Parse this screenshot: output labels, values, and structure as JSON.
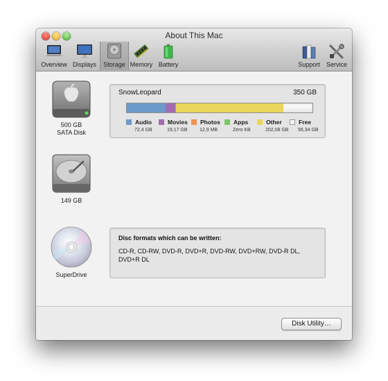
{
  "window": {
    "title": "About This Mac"
  },
  "toolbar": {
    "items": [
      {
        "label": "Overview",
        "icon": "monitor-icon"
      },
      {
        "label": "Displays",
        "icon": "display-icon"
      },
      {
        "label": "Storage",
        "icon": "hard-drive-icon",
        "selected": true
      },
      {
        "label": "Memory",
        "icon": "memory-chip-icon"
      },
      {
        "label": "Battery",
        "icon": "battery-icon"
      },
      {
        "label": "Support",
        "icon": "support-books-icon"
      },
      {
        "label": "Service",
        "icon": "service-tools-icon"
      }
    ]
  },
  "devices": [
    {
      "icon": "hard-drive-icon",
      "label_line1": "500 GB",
      "label_line2": "SATA Disk",
      "volume": {
        "name": "SnowLeopard",
        "capacity": "350 GB",
        "usage_fractions": {
          "audio": 0.21,
          "movies": 0.05,
          "photos": 0.003,
          "apps": 0.002,
          "other": 0.58,
          "free": 0.155
        },
        "legend": [
          {
            "key": "audio",
            "name": "Audio",
            "size": "72,4 GB",
            "color": "#6d9ac9"
          },
          {
            "key": "movies",
            "name": "Movies",
            "size": "19,17 GB",
            "color": "#a56bb0"
          },
          {
            "key": "photos",
            "name": "Photos",
            "size": "12,9 MB",
            "color": "#f0944f"
          },
          {
            "key": "apps",
            "name": "Apps",
            "size": "Zero KB",
            "color": "#7cc46a"
          },
          {
            "key": "other",
            "name": "Other",
            "size": "202,08 GB",
            "color": "#ead65a"
          },
          {
            "key": "free",
            "name": "Free",
            "size": "56,34 GB",
            "color": "#f4f4f4"
          }
        ]
      }
    },
    {
      "icon": "hard-drive-icon",
      "label_line1": "149 GB"
    },
    {
      "icon": "optical-disc-icon",
      "label_line1": "SuperDrive",
      "disc_formats": {
        "heading": "Disc formats which can be written:",
        "line1": "CD-R, CD-RW, DVD-R, DVD+R, DVD-RW, DVD+RW, DVD-R DL,",
        "line2": "DVD+R DL"
      }
    }
  ],
  "buttons": {
    "disk_utility": "Disk Utility…"
  }
}
